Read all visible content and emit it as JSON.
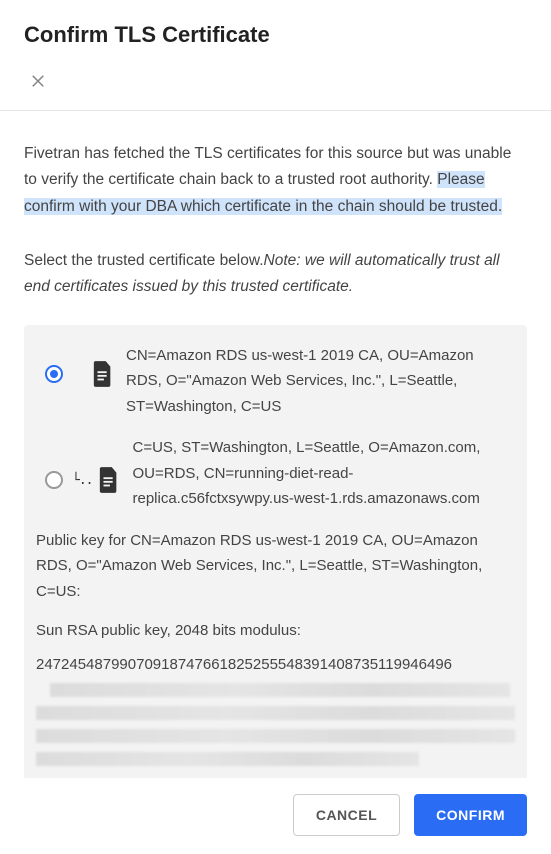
{
  "header": {
    "title": "Confirm TLS Certificate"
  },
  "description": {
    "part1": "Fivetran has fetched the TLS certificates for this source but was unable to verify the certificate chain back to a trusted root authority. ",
    "highlighted": "Please confirm with your DBA which certificate in the chain should be trusted."
  },
  "instruction": {
    "lead": "Select the trusted certificate below.",
    "note_label": "Note:",
    "note_text": " we will automatically trust all end certificates issued by this trusted certificate."
  },
  "certificates": [
    {
      "label": "CN=Amazon RDS us-west-1 2019 CA, OU=Amazon RDS, O=\"Amazon Web Services, Inc.\", L=Seattle, ST=Washington, C=US",
      "selected": true,
      "child": false
    },
    {
      "label": "C=US, ST=Washington, L=Seattle, O=Amazon.com, OU=RDS, CN=running-diet-read-replica.c56fctxsywpy.us-west-1.rds.amazonaws.com",
      "selected": false,
      "child": true
    }
  ],
  "public_key": {
    "heading": "Public key for CN=Amazon RDS us-west-1 2019 CA, OU=Amazon RDS, O=\"Amazon Web Services, Inc.\", L=Seattle, ST=Washington, C=US:",
    "modulus_label": "Sun RSA public key, 2048 bits modulus:",
    "modulus_value": "24724548799070918747661825255548391408735119946496"
  },
  "footer": {
    "cancel": "CANCEL",
    "confirm": "CONFIRM"
  }
}
